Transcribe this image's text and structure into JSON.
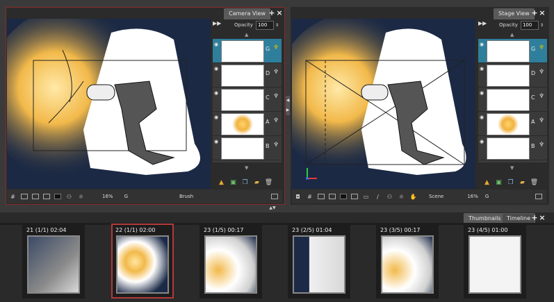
{
  "camera_view": {
    "tab_label": "Camera View",
    "opacity_label": "Opacity",
    "opacity_value": "100",
    "zoom": "16%",
    "layer_indicator": "G",
    "tool": "Brush"
  },
  "stage_view": {
    "tab_label": "Stage View",
    "opacity_label": "Opacity",
    "opacity_value": "100",
    "scene_label": "Scene",
    "zoom": "16%",
    "layer_indicator": "G"
  },
  "layers": [
    {
      "name": "G"
    },
    {
      "name": "D"
    },
    {
      "name": "C"
    },
    {
      "name": "A"
    },
    {
      "name": "B"
    }
  ],
  "bottom_panel": {
    "tabs": [
      "Thumbnails",
      "Timeline"
    ],
    "active_tab": "Thumbnails"
  },
  "thumbnails": [
    {
      "label": "21 (1/1) 02:04"
    },
    {
      "label": "22 (1/1) 02:00"
    },
    {
      "label": "23 (1/5) 00:17"
    },
    {
      "label": "23 (2/5) 01:04"
    },
    {
      "label": "23 (3/5) 00:17"
    },
    {
      "label": "23 (4/5) 01:00"
    }
  ],
  "colors": {
    "accent": "#2f7f9c",
    "selection_border": "#b23a3a",
    "panel_bg": "#2b2b2b"
  }
}
